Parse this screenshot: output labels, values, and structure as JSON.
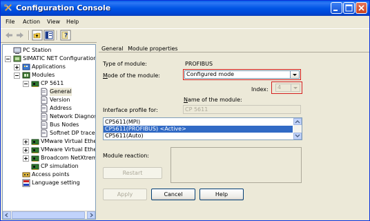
{
  "window": {
    "title": "Configuration Console",
    "icon": "tools-icon",
    "controls": [
      "minimize-icon",
      "maximize-icon",
      "close-icon"
    ]
  },
  "menu": {
    "file": "File",
    "action": "Action",
    "view": "View",
    "help": "Help"
  },
  "toolbar": {
    "icons": [
      "back-arrow-icon",
      "forward-arrow-icon",
      "up-folder-icon",
      "show-hide-tree-icon",
      "help-icon"
    ]
  },
  "tree": {
    "items": [
      {
        "label": "PC Station",
        "icon": "pc-station-icon",
        "expander": "none"
      },
      {
        "label": "SIMATIC NET Configuration",
        "icon": "network-icon",
        "expander": "minus"
      },
      {
        "label": "Applications",
        "icon": "applications-icon",
        "expander": "plus"
      },
      {
        "label": "Modules",
        "icon": "modules-icon",
        "expander": "minus"
      },
      {
        "label": "CP 5611",
        "icon": "card-icon",
        "expander": "minus"
      },
      {
        "label": "General",
        "icon": "page-icon",
        "expander": "none",
        "selected": true
      },
      {
        "label": "Version",
        "icon": "page-icon",
        "expander": "none"
      },
      {
        "label": "Address",
        "icon": "page-icon",
        "expander": "none"
      },
      {
        "label": "Network Diagnos",
        "icon": "page-icon",
        "expander": "none"
      },
      {
        "label": "Bus Nodes",
        "icon": "page-icon",
        "expander": "none"
      },
      {
        "label": "Softnet DP trace",
        "icon": "page-icon",
        "expander": "none"
      },
      {
        "label": "VMware Virtual Ether",
        "icon": "card-icon",
        "expander": "plus"
      },
      {
        "label": "VMware Virtual Ether",
        "icon": "card-icon",
        "expander": "plus"
      },
      {
        "label": "Broadcom NetXtreme",
        "icon": "card-icon",
        "expander": "plus"
      },
      {
        "label": "CP simulation",
        "icon": "card-icon",
        "expander": "none"
      },
      {
        "label": "Access points",
        "icon": "access-points-icon",
        "expander": "none"
      },
      {
        "label": "Language setting",
        "icon": "language-icon",
        "expander": "none"
      }
    ]
  },
  "tabs": {
    "general": "General",
    "module_properties": "Module properties"
  },
  "form": {
    "type_label": "Type of module:",
    "type_value": "PROFIBUS",
    "mode_label": "Mode of the module:",
    "mode_value": "Configured mode",
    "index_label": "Index:",
    "index_value": "4",
    "name_label": "Name of the module:",
    "name_value": "CP 5611",
    "profile_label": "Interface profile for:",
    "profiles": [
      {
        "label": "CP5611(MPI)",
        "selected": false
      },
      {
        "label": "CP5611(PROFIBUS) <Active>",
        "selected": true
      },
      {
        "label": "CP5611(Auto)",
        "selected": false
      }
    ],
    "reaction_label": "Module reaction:",
    "restart": "Restart"
  },
  "buttons": {
    "apply": "Apply",
    "cancel": "Cancel",
    "help": "Help"
  },
  "colors": {
    "titlebar": "#0055e5",
    "selection": "#316ac5",
    "highlight_frame": "#d41e1e"
  }
}
